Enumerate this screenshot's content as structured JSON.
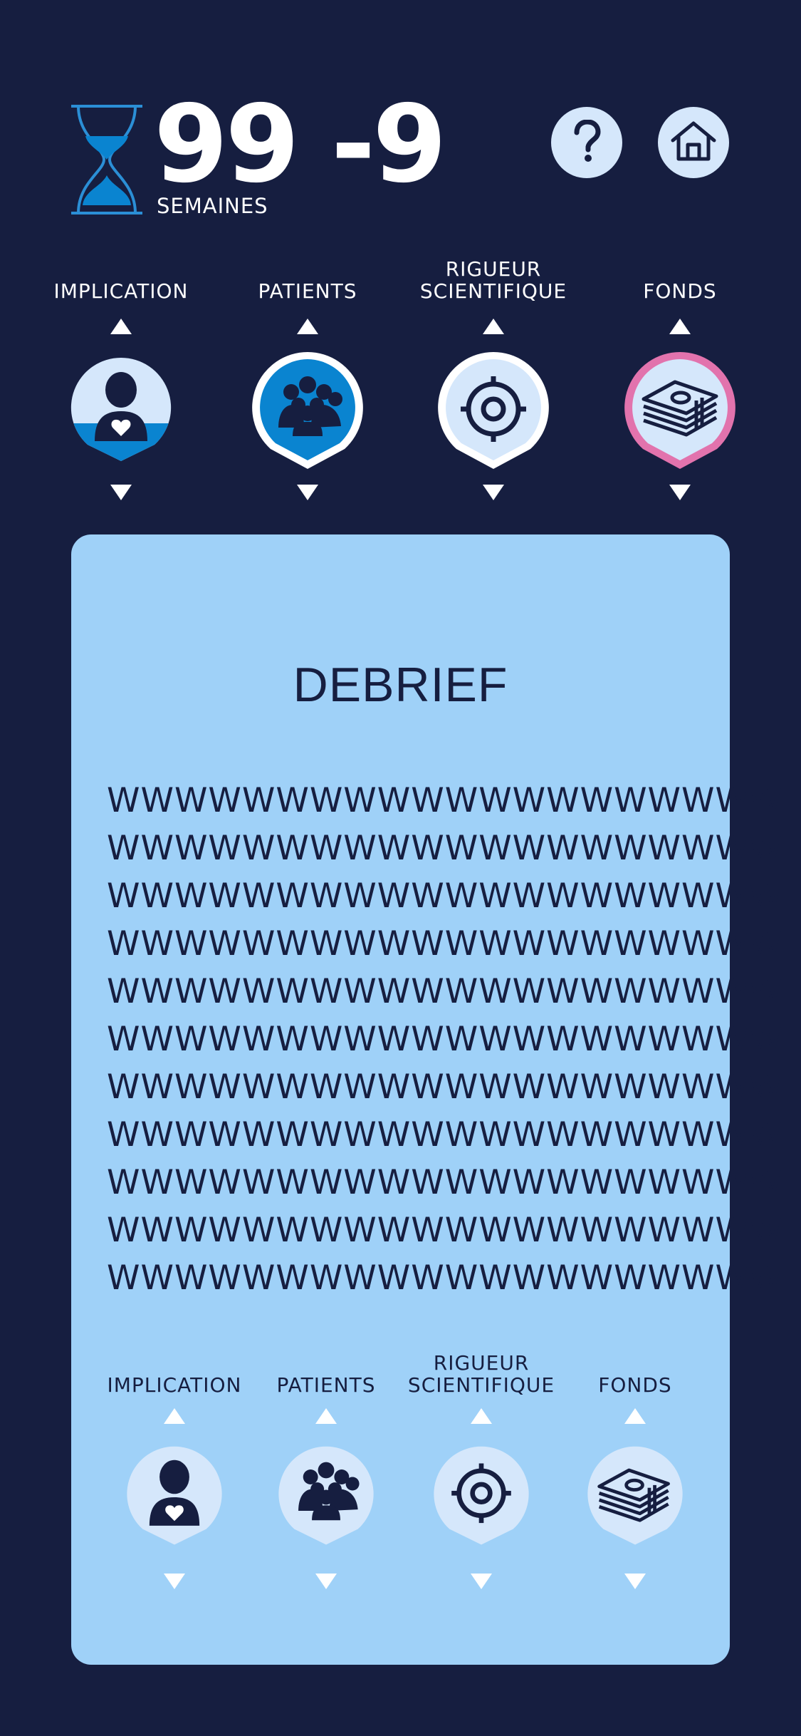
{
  "header": {
    "weeks_value": "99 -9",
    "weeks_unit": "SEMAINES",
    "hourglass_icon": "hourglass-icon",
    "help_icon": "help-icon",
    "home_icon": "home-icon"
  },
  "gauges": [
    {
      "label": "IMPLICATION",
      "icon": "user-heart-icon",
      "fill_fraction": 0.35
    },
    {
      "label": "PATIENTS",
      "icon": "people-group-icon",
      "fill_fraction": 1.0
    },
    {
      "label": "RIGUEUR\nSCIENTIFIQUE",
      "icon": "target-icon",
      "fill_fraction": 0.0
    },
    {
      "label": "FONDS",
      "icon": "money-stack-icon",
      "fill_fraction": 0.0,
      "ring_color": "#e273ad"
    }
  ],
  "debrief": {
    "title": "DEBRIEF",
    "lines": [
      "WWWWWWWWWWWWWWWWWWWW",
      "WWWWWWWWWWWWWWWWWWWW",
      "WWWWWWWWWWWWWWWWWWWW",
      "WWWWWWWWWWWWWWWWWWWW",
      "WWWWWWWWWWWWWWWWWWWW",
      "WWWWWWWWWWWWWWWWWWWW",
      "WWWWWWWWWWWWWWWWWWWW",
      "WWWWWWWWWWWWWWWWWWWW",
      "WWWWWWWWWWWWWWWWWWWW",
      "WWWWWWWWWWWWWWWWWWWW",
      "WWWWWWWWWWWWWWWWWWWW"
    ],
    "gauges": [
      {
        "label": "IMPLICATION",
        "icon": "user-heart-icon"
      },
      {
        "label": "PATIENTS",
        "icon": "people-group-icon"
      },
      {
        "label": "RIGUEUR\nSCIENTIFIQUE",
        "icon": "target-icon"
      },
      {
        "label": "FONDS",
        "icon": "money-stack-icon"
      }
    ]
  },
  "colors": {
    "background": "#161e40",
    "card": "#9fd1f8",
    "badge_light": "#d5e7fb",
    "badge_fill": "#0a84d0",
    "funds_ring": "#e273ad",
    "ink": "#161e40"
  }
}
